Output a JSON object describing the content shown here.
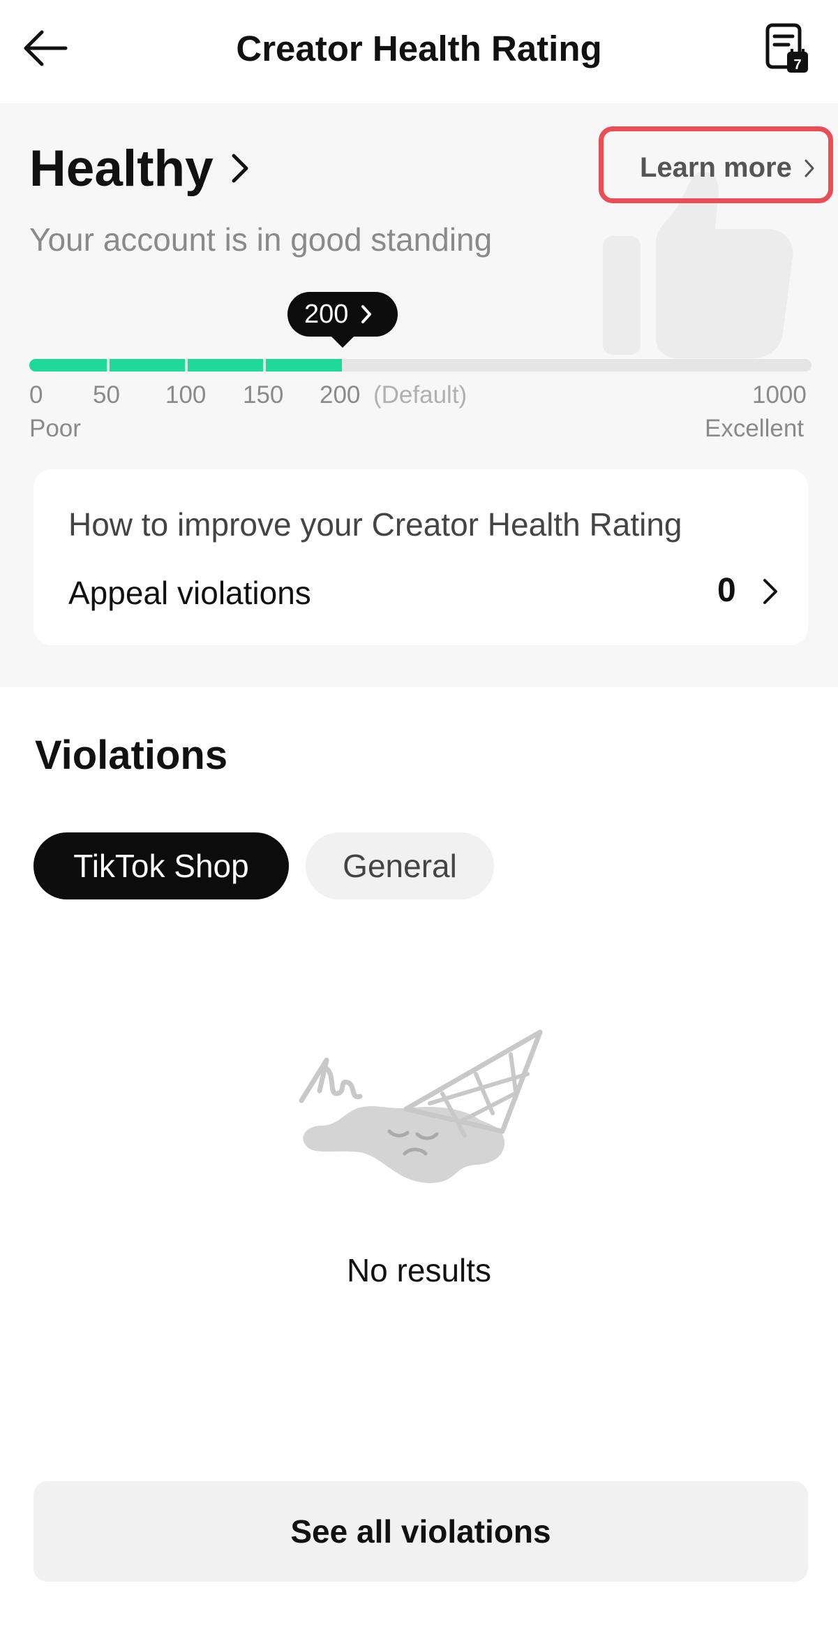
{
  "header": {
    "title": "Creator Health Rating",
    "back_icon": "arrow-left-icon",
    "doc_icon": "document-calendar-icon",
    "doc_badge": "7"
  },
  "rating": {
    "status": "Healthy",
    "subtitle": "Your account is in good standing",
    "learn_more": "Learn more",
    "score": "200",
    "score_fraction": 0.2,
    "accent_color": "#1ed99a",
    "highlight_color": "#ec4c54",
    "scale": {
      "t0": "0",
      "t50": "50",
      "t100": "100",
      "t150": "150",
      "t200": "200",
      "default_label": "(Default)",
      "t1000": "1000",
      "low_label": "Poor",
      "high_label": "Excellent"
    }
  },
  "improve": {
    "title": "How to improve your Creator Health Rating",
    "row_label": "Appeal violations",
    "row_count": "0"
  },
  "violations": {
    "title": "Violations",
    "tabs": [
      {
        "label": "TikTok Shop",
        "active": true
      },
      {
        "label": "General",
        "active": false
      }
    ],
    "empty_text": "No results",
    "see_all": "See all violations"
  }
}
